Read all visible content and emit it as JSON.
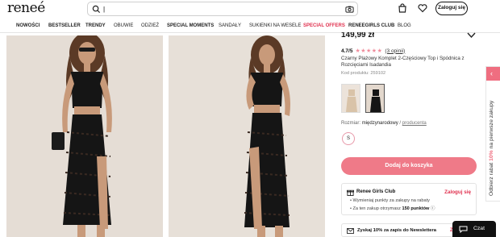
{
  "header": {
    "logo": "reneé",
    "search_placeholder": "",
    "login_label": "Zaloguj się"
  },
  "nav": {
    "items": [
      {
        "label": "NOWOŚCI",
        "style": "bold"
      },
      {
        "label": "BESTSELLER",
        "style": "bold"
      },
      {
        "label": "TRENDY",
        "style": "bold"
      },
      {
        "label": "OBUWIE",
        "style": "normal"
      },
      {
        "label": "ODZIEŻ",
        "style": "normal"
      },
      {
        "label": "SPECIAL MOMENTS",
        "style": "bold"
      },
      {
        "label": "SANDAŁY",
        "style": "normal"
      },
      {
        "label": "SUKIENKI NA WESELE",
        "style": "normal"
      },
      {
        "label": "SPECIAL OFFERS",
        "style": "red"
      },
      {
        "label": "RENEEGIRLS CLUB",
        "style": "bold"
      },
      {
        "label": "BLOG",
        "style": "normal"
      }
    ]
  },
  "product": {
    "price": "149,99 zł",
    "rating_value": "4.7/5",
    "stars": "★★★★★",
    "reviews_link": "(3 opinii)",
    "name": "Czarny Plażowy Komplet 2-Częściowy Top i Spódnica z Rozcięciami Isadandia",
    "code": "Kod produktu: 259102",
    "size_label": "Rozmiar:",
    "size_system": "międzynarodowy",
    "size_separator": "/",
    "size_producer": "producenta",
    "size_option": "S",
    "add_to_cart": "Dodaj do koszyka"
  },
  "club": {
    "title": "Renee Girls Club",
    "login": "Zaloguj się",
    "line1": "Wymieniaj punkty za zakupy na rabaty",
    "line2_prefix": "Za ten zakup otrzymasz ",
    "line2_points": "150 punktów",
    "line2_info": "ⓘ"
  },
  "newsletter": {
    "text": "Zyskaj 10% za zapis do Newslettera",
    "extra": "Z"
  },
  "promo": {
    "text_prefix": "Odbierz rabat ",
    "highlight": "10%",
    "text_suffix": " na pierwsze zakupy",
    "arrow": "‹"
  },
  "chat": {
    "label": "Czat"
  },
  "colors": {
    "accent": "#ef7a88",
    "brand_red": "#e0304e",
    "photo_bg": "#e5ddd5"
  },
  "icons": [
    "search-icon",
    "camera-icon",
    "bag-icon",
    "heart-icon",
    "chevron-down-icon",
    "gift-icon",
    "mail-icon",
    "chat-icon"
  ]
}
